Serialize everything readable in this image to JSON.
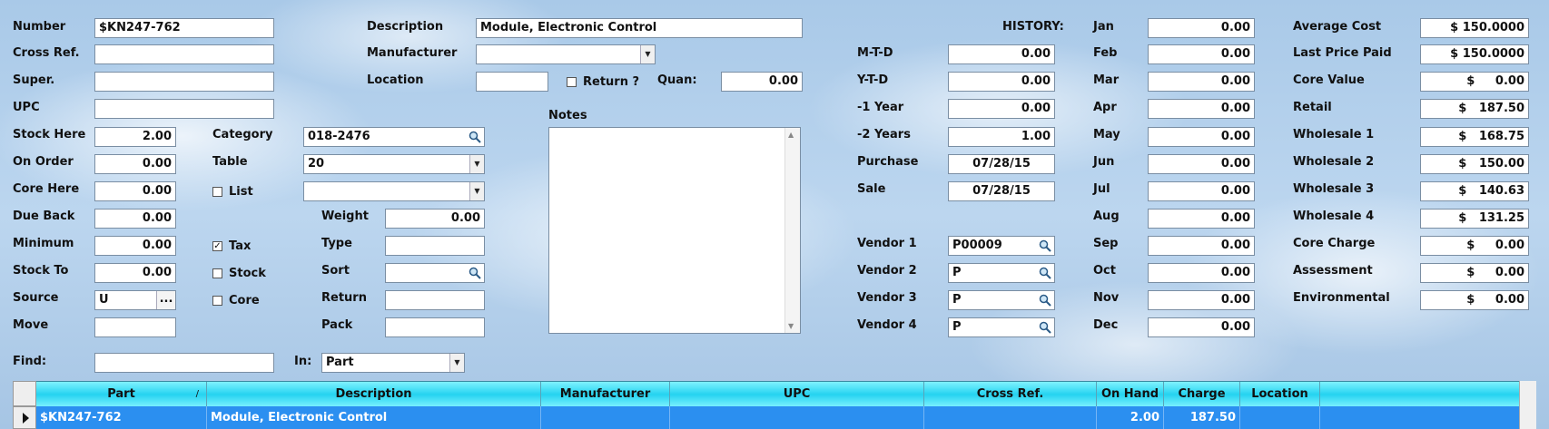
{
  "part": {
    "number_label": "Number",
    "number_value": "$KN247-762",
    "crossref_label": "Cross Ref.",
    "crossref_value": "",
    "super_label": "Super.",
    "super_value": "",
    "upc_label": "UPC",
    "upc_value": "",
    "stockhere_label": "Stock Here",
    "stockhere_value": "2.00",
    "onorder_label": "On Order",
    "onorder_value": "0.00",
    "corehere_label": "Core Here",
    "corehere_value": "0.00",
    "dueback_label": "Due Back",
    "dueback_value": "0.00",
    "minimum_label": "Minimum",
    "minimum_value": "0.00",
    "stockto_label": "Stock To",
    "stockto_value": "0.00",
    "source_label": "Source",
    "source_value": "U",
    "source_button": "...",
    "move_label": "Move",
    "move_value": ""
  },
  "mid": {
    "category_label": "Category",
    "category_value": "018-2476",
    "table_label": "Table",
    "table_value": "20",
    "list_label": "List",
    "list_value": "",
    "tax_label": "Tax",
    "tax_checked": true,
    "stock_label": "Stock",
    "stock_checked": false,
    "core_label": "Core",
    "core_checked": false,
    "weight_label": "Weight",
    "weight_value": "0.00",
    "type_label": "Type",
    "type_value": "",
    "sort_label": "Sort",
    "sort_value": "",
    "return_label": "Return",
    "return_value": "",
    "pack_label": "Pack",
    "pack_value": ""
  },
  "desc": {
    "description_label": "Description",
    "description_value": "Module, Electronic Control",
    "manufacturer_label": "Manufacturer",
    "manufacturer_value": "",
    "location_label": "Location",
    "location_value": "",
    "returnq_label": "Return ?",
    "returnq_checked": false,
    "quan_label": "Quan:",
    "quan_value": "0.00",
    "notes_label": "Notes",
    "notes_value": ""
  },
  "history": {
    "title": "HISTORY:",
    "mtd_label": "M-T-D",
    "mtd_value": "0.00",
    "ytd_label": "Y-T-D",
    "ytd_value": "0.00",
    "y1_label": "-1 Year",
    "y1_value": "0.00",
    "y2_label": "-2 Years",
    "y2_value": "1.00",
    "purchase_label": "Purchase",
    "purchase_value": "07/28/15",
    "sale_label": "Sale",
    "sale_value": "07/28/15",
    "vendor1_label": "Vendor 1",
    "vendor1_value": "P00009",
    "vendor2_label": "Vendor 2",
    "vendor2_value": "P",
    "vendor3_label": "Vendor 3",
    "vendor3_value": "P",
    "vendor4_label": "Vendor 4",
    "vendor4_value": "P",
    "months": [
      {
        "label": "Jan",
        "value": "0.00"
      },
      {
        "label": "Feb",
        "value": "0.00"
      },
      {
        "label": "Mar",
        "value": "0.00"
      },
      {
        "label": "Apr",
        "value": "0.00"
      },
      {
        "label": "May",
        "value": "0.00"
      },
      {
        "label": "Jun",
        "value": "0.00"
      },
      {
        "label": "Jul",
        "value": "0.00"
      },
      {
        "label": "Aug",
        "value": "0.00"
      },
      {
        "label": "Sep",
        "value": "0.00"
      },
      {
        "label": "Oct",
        "value": "0.00"
      },
      {
        "label": "Nov",
        "value": "0.00"
      },
      {
        "label": "Dec",
        "value": "0.00"
      }
    ]
  },
  "prices": [
    {
      "label": "Average Cost",
      "value": "$ 150.0000"
    },
    {
      "label": "Last Price Paid",
      "value": "$ 150.0000"
    },
    {
      "label": "Core Value",
      "value": "$     0.00"
    },
    {
      "label": "Retail",
      "value": "$   187.50"
    },
    {
      "label": "Wholesale 1",
      "value": "$   168.75"
    },
    {
      "label": "Wholesale 2",
      "value": "$   150.00"
    },
    {
      "label": "Wholesale 3",
      "value": "$   140.63"
    },
    {
      "label": "Wholesale 4",
      "value": "$   131.25"
    },
    {
      "label": "Core Charge",
      "value": "$     0.00"
    },
    {
      "label": "Assessment",
      "value": "$     0.00"
    },
    {
      "label": "Environmental",
      "value": "$     0.00"
    }
  ],
  "find": {
    "find_label": "Find:",
    "find_value": "",
    "in_label": "In:",
    "in_value": "Part"
  },
  "grid": {
    "columns": [
      "Part",
      "Description",
      "Manufacturer",
      "UPC",
      "Cross Ref.",
      "On Hand",
      "Charge",
      "Location",
      ""
    ],
    "sort_indicator": "/",
    "rows": [
      [
        "$KN247-762",
        "Module, Electronic Control",
        "",
        "",
        "",
        "2.00",
        "187.50",
        "",
        ""
      ]
    ]
  },
  "icons": {
    "search": "magnifier-icon",
    "dropdown": "chevron-down-icon",
    "row_pointer": "triangle-right-icon"
  }
}
